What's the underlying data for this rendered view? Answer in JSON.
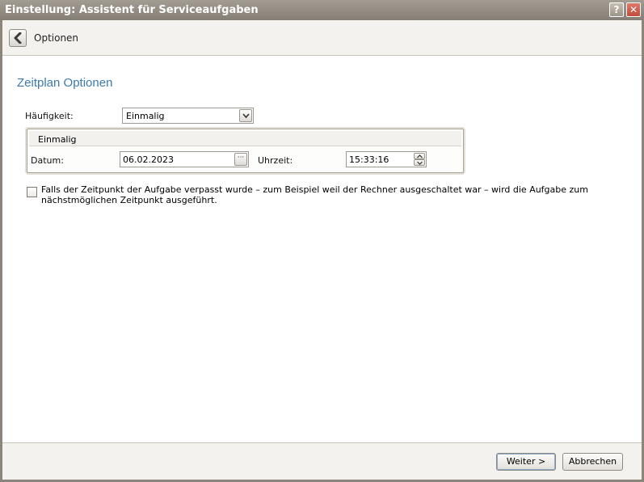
{
  "window": {
    "title": "Einstellung: Assistent für Serviceaufgaben",
    "help_glyph": "?",
    "close_glyph": "✕"
  },
  "header": {
    "back_icon": "chevron-left-icon",
    "label": "Optionen"
  },
  "section": {
    "title": "Zeitplan Optionen"
  },
  "frequency": {
    "label": "Häufigkeit:",
    "value": "Einmalig"
  },
  "group": {
    "title": "Einmalig",
    "date_label": "Datum:",
    "date_value": "06.02.2023",
    "date_button": "···",
    "time_label": "Uhrzeit:",
    "time_value": "15:33:16"
  },
  "missed_run": {
    "checked": false,
    "text": "Falls der Zeitpunkt der Aufgabe verpasst wurde – zum Beispiel weil der Rechner ausgeschaltet war – wird die Aufgabe zum nächstmöglichen Zeitpunkt ausgeführt."
  },
  "footer": {
    "next_label": "Weiter >",
    "cancel_label": "Abbrechen"
  }
}
